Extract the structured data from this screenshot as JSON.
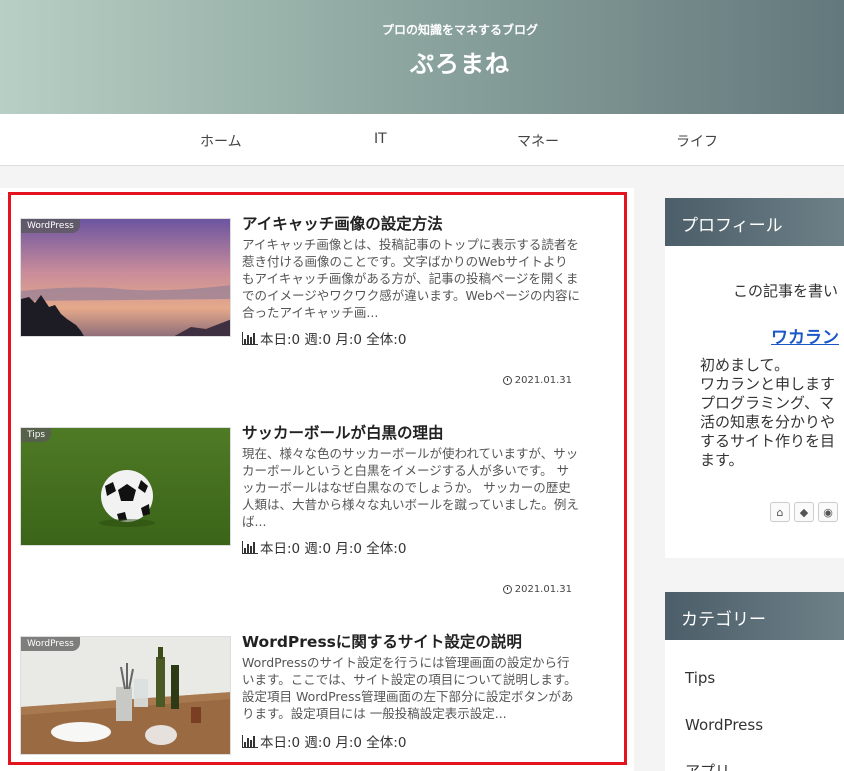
{
  "header": {
    "tagline": "プロの知識をマネするブログ",
    "title": "ぷろまね"
  },
  "nav": {
    "items": [
      "ホーム",
      "IT",
      "マネー",
      "ライフ"
    ]
  },
  "posts": [
    {
      "category": "WordPress",
      "title": "アイキャッチ画像の設定方法",
      "excerpt": "アイキャッチ画像とは、投稿記事のトップに表示する読者を惹き付ける画像のことです。文字ばかりのWebサイトよりもアイキャッチ画像がある方が、記事の投稿ページを開くまでのイメージやワクワク感が違います。Webページの内容に合ったアイキャッチ画...",
      "stats": "本日:0 週:0 月:0 全体:0",
      "date": "2021.01.31"
    },
    {
      "category": "Tips",
      "title": "サッカーボールが白黒の理由",
      "excerpt": "現在、様々な色のサッカーボールが使われていますが、サッカーボールというと白黒をイメージする人が多いです。 サッカーボールはなぜ白黒なのでしょうか。 サッカーの歴史 人類は、大昔から様々な丸いボールを蹴っていました。例えば...",
      "stats": "本日:0 週:0 月:0 全体:0",
      "date": "2021.01.31"
    },
    {
      "category": "WordPress",
      "title": "WordPressに関するサイト設定の説明",
      "excerpt": "WordPressのサイト設定を行うには管理画面の設定から行います。ここでは、サイト設定の項目について説明します。 設定項目 WordPress管理画面の左下部分に設定ボタンがあります。設定項目には 一般投稿設定表示設定...",
      "stats": "本日:0 週:0 月:0 全体:0",
      "date": ""
    }
  ],
  "sidebar": {
    "profile": {
      "heading": "プロフィール",
      "intro": "この記事を書い",
      "name": "ワカラン",
      "text": "初めまして。\nワカランと申します\nプログラミング、マ\n活の知恵を分かりや\nするサイト作りを目\nます。"
    },
    "category": {
      "heading": "カテゴリー",
      "items": [
        "Tips",
        "WordPress",
        "アプリ"
      ]
    }
  },
  "colors": {
    "highlight_frame": "#e3141d",
    "link": "#1a57c9",
    "widget_head": "#4b5e69"
  }
}
